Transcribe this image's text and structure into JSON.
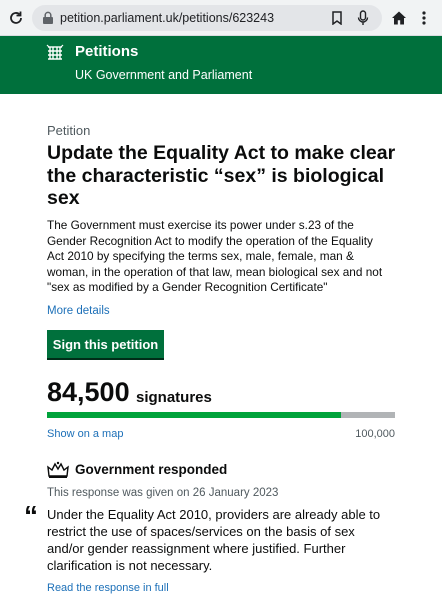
{
  "browser": {
    "url": "petition.parliament.uk/petitions/623243"
  },
  "header": {
    "title": "Petitions",
    "subtitle": "UK Government and Parliament"
  },
  "petition": {
    "caption": "Petition",
    "title": "Update the Equality Act to make clear the characteristic “sex” is biological sex",
    "summary": "The Government must exercise its power under s.23 of the Gender Recognition Act to modify the operation of the Equality Act 2010 by specifying the terms sex, male, female, man & woman, in the operation of that law, mean biological sex and not \"sex as modified by a Gender Recognition Certificate\"",
    "more_details": "More details",
    "sign_label": "Sign this petition"
  },
  "signatures": {
    "count": "84,500",
    "label": "signatures",
    "progress_fraction": 0.845,
    "target": "100,000",
    "show_map": "Show on a map"
  },
  "response": {
    "heading": "Government responded",
    "date_text": "This response was given on 26 January 2023",
    "quote": "Under the Equality Act 2010, providers are already able to restrict the use of spaces/services on the basis of sex and/or gender reassignment where justified. Further clarification is not necessary.",
    "read_full": "Read the response in full"
  },
  "colors": {
    "header_green": "#00703c",
    "progress_green": "#00a33b",
    "link_blue": "#1d70b8"
  }
}
